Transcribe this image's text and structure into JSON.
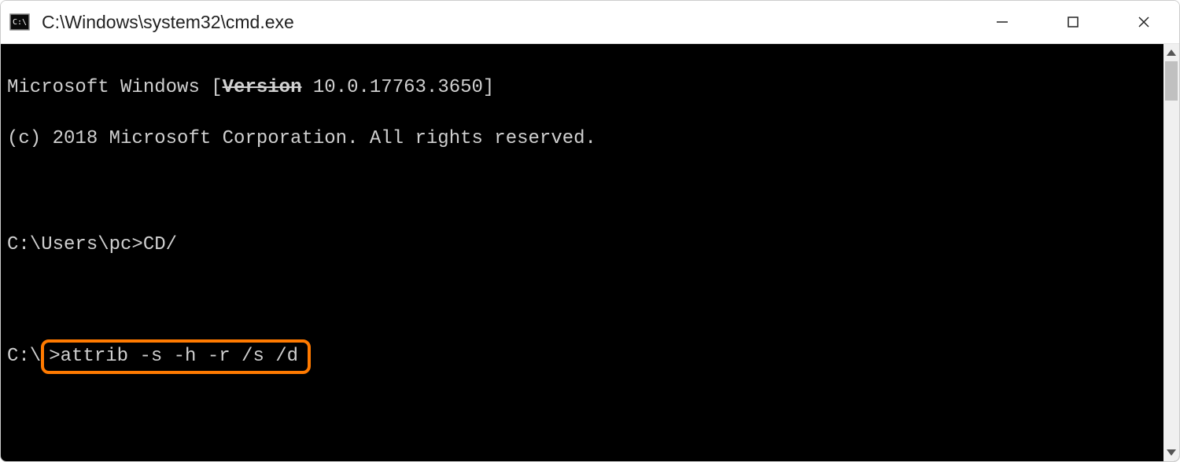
{
  "window": {
    "title": "C:\\Windows\\system32\\cmd.exe"
  },
  "terminal": {
    "header_prefix": "Microsoft Windows [",
    "version_label": "Version",
    "header_suffix": " 10.0.17763.3650]",
    "copyright": "(c) 2018 Microsoft Corporation. All rights reserved.",
    "prompt1_full": "C:\\Users\\pc>CD/",
    "prompt2_prefix": "C:\\",
    "prompt2_command": ">attrib -s -h -r /s /d"
  }
}
